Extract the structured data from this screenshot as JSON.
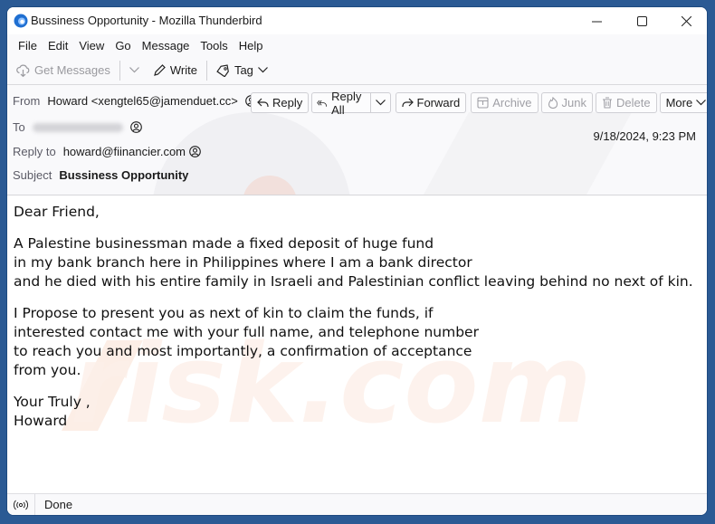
{
  "window": {
    "title": "Bussiness Opportunity - Mozilla Thunderbird",
    "app_icon": "thunderbird-logo-icon",
    "controls": [
      "minimize",
      "maximize",
      "close"
    ]
  },
  "menubar": {
    "items": [
      {
        "label": "File"
      },
      {
        "label": "Edit"
      },
      {
        "label": "View"
      },
      {
        "label": "Go"
      },
      {
        "label": "Message"
      },
      {
        "label": "Tools"
      },
      {
        "label": "Help"
      }
    ]
  },
  "toolbar": {
    "get_messages": {
      "label": "Get Messages",
      "icon": "cloud-download-icon",
      "disabled": true
    },
    "write": {
      "label": "Write",
      "icon": "pencil-icon"
    },
    "tag": {
      "label": "Tag",
      "icon": "tag-icon"
    }
  },
  "header": {
    "from_label": "From",
    "from_value": "Howard <xengtel65@jamenduet.cc>",
    "to_label": "To",
    "to_value_redacted": true,
    "reply_to_label": "Reply to",
    "reply_to_value": "howard@fiinancier.com",
    "subject_label": "Subject",
    "subject_value": "Bussiness Opportunity",
    "date": "9/18/2024, 9:23 PM",
    "buttons": {
      "reply": "Reply",
      "reply_all": "Reply All",
      "forward": "Forward",
      "archive": "Archive",
      "junk": "Junk",
      "delete": "Delete",
      "more": "More"
    }
  },
  "message": {
    "greeting": "Dear Friend,",
    "paragraph1": "A Palestine businessman made a fixed deposit of huge fund\nin my bank branch here in Philippines where I am a bank director\nand he died with his entire family in Israeli and Palestinian conflict leaving behind no next of kin.",
    "paragraph2": "I Propose to present you as next of kin to claim the funds, if\ninterested contact me with your full name, and telephone number\nto reach you and most importantly, a confirmation of acceptance\nfrom you.",
    "closing": "Your Truly ,\nHoward"
  },
  "statusbar": {
    "icon": "connection-status-icon",
    "text": "Done"
  }
}
